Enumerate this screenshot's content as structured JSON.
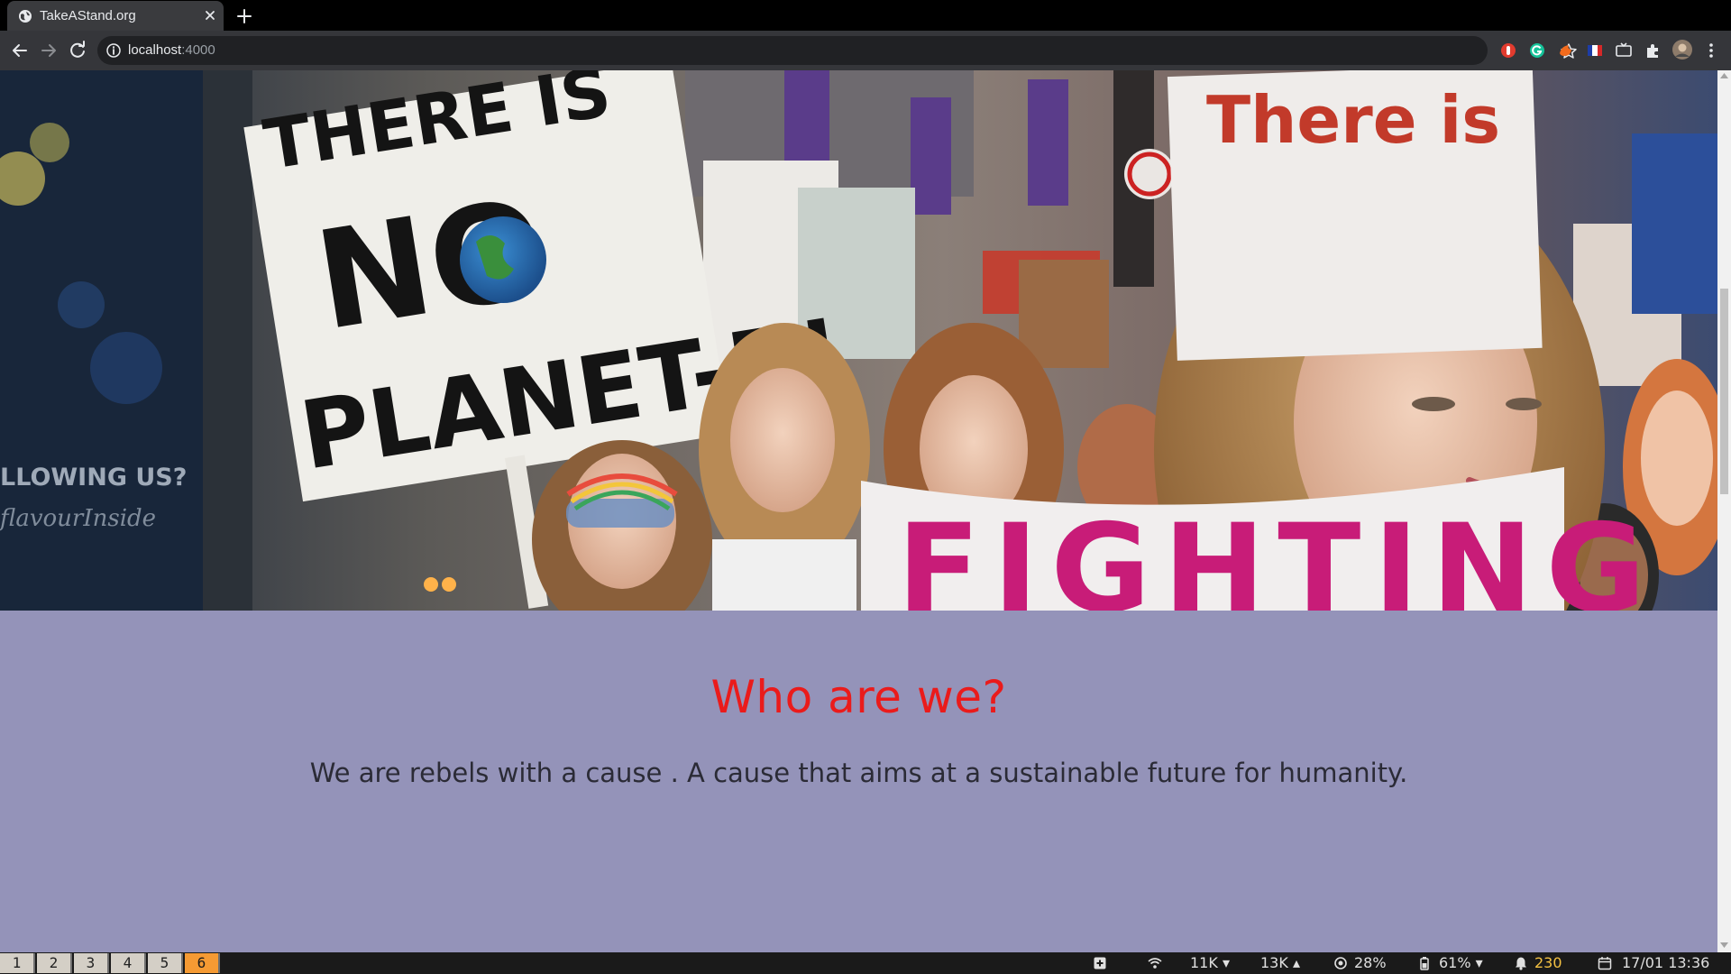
{
  "browser": {
    "tab_title": "TakeAStand.org",
    "url_host": "localhost",
    "url_port": ":4000"
  },
  "page": {
    "hero_signs": {
      "sign_left_line1": "THERE IS",
      "sign_left_line2": "NO",
      "sign_left_line3": "PLANET-B!",
      "sign_right": "There is",
      "banner": "FIGHTING",
      "shop_left_line1": "LLOWING US?",
      "shop_left_line2": "flavourInside"
    },
    "about": {
      "heading": "Who are we?",
      "body": "We are rebels with a cause . A cause that aims at a sustainable future for humanity."
    },
    "colors": {
      "section_bg": "#9493b9",
      "heading": "#ea1b1b",
      "body_text": "#2b2b36"
    }
  },
  "statusbar": {
    "workspaces": [
      "1",
      "2",
      "3",
      "4",
      "5",
      "6"
    ],
    "active_workspace": "6",
    "net_down": "11K",
    "net_up": "13K",
    "cpu": "28%",
    "battery": "61%",
    "notifications": "230",
    "datetime": "17/01 13:36"
  }
}
